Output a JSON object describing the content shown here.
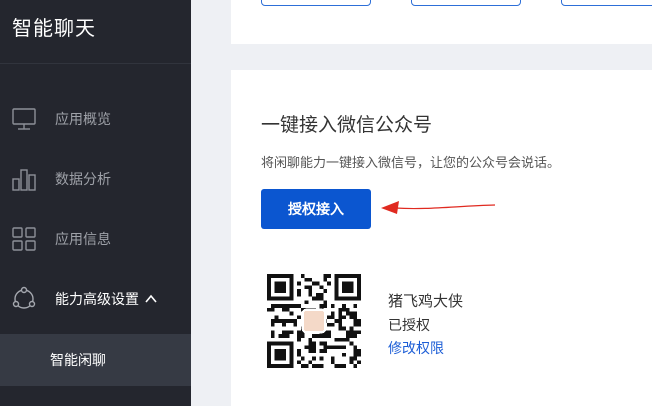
{
  "sidebar": {
    "title": "智能聊天",
    "items": [
      {
        "label": "应用概览",
        "icon": "monitor-icon"
      },
      {
        "label": "数据分析",
        "icon": "bar-chart-icon"
      },
      {
        "label": "应用信息",
        "icon": "grid-icon"
      },
      {
        "label": "能力高级设置",
        "icon": "share-icon",
        "expanded": true
      }
    ],
    "sub_items": [
      {
        "label": "智能闲聊",
        "active": true
      }
    ]
  },
  "wechat_card": {
    "title": "一键接入微信公众号",
    "description": "将闲聊能力一键接入微信号，让您的公众号会说话。",
    "authorize_button": "授权接入",
    "account": {
      "name": "猪飞鸡大侠",
      "status": "已授权",
      "modify_link": "修改权限"
    }
  },
  "colors": {
    "sidebar_bg": "#24262e",
    "active_sub_bg": "#363a44",
    "primary": "#0b56d0",
    "link": "#1d5ed6",
    "annotation_arrow": "#e02a20"
  }
}
